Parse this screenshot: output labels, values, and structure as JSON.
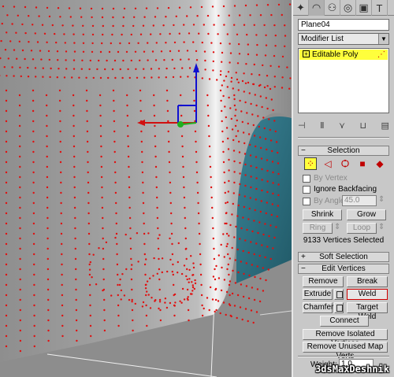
{
  "tabs": [
    {
      "name": "create-tab",
      "glyph": "✦"
    },
    {
      "name": "modify-tab",
      "glyph": "◠"
    },
    {
      "name": "hierarchy-tab",
      "glyph": "⚇"
    },
    {
      "name": "motion-tab",
      "glyph": "◎"
    },
    {
      "name": "display-tab",
      "glyph": "▣"
    },
    {
      "name": "utilities-tab",
      "glyph": "T"
    }
  ],
  "object_name": "Plane04",
  "modifier_list": "Modifier List",
  "stack": {
    "item": "Editable Poly"
  },
  "selection": {
    "title": "Selection",
    "by_vertex": "By Vertex",
    "ignore_backfacing": "Ignore Backfacing",
    "by_angle": "By Angle:",
    "angle_value": "45.0",
    "shrink": "Shrink",
    "grow": "Grow",
    "ring": "Ring",
    "loop": "Loop",
    "status": "9133 Vertices Selected"
  },
  "soft_selection": {
    "title": "Soft Selection"
  },
  "edit_vertices": {
    "title": "Edit Vertices",
    "remove": "Remove",
    "break": "Break",
    "extrude": "Extrude",
    "weld": "Weld",
    "chamfer": "Chamfer",
    "target_weld": "Target Weld",
    "connect": "Connect",
    "remove_isolated": "Remove Isolated Vertices",
    "remove_unused": "Remove Unused Map Verts",
    "weight_label": "Weight:",
    "weight_value": "1.0"
  },
  "watermark": "3dsMaxDeshnik",
  "colors": {
    "vertex": "#e01010",
    "highlight": "#ffff3c",
    "teal": "#2a6f80"
  }
}
